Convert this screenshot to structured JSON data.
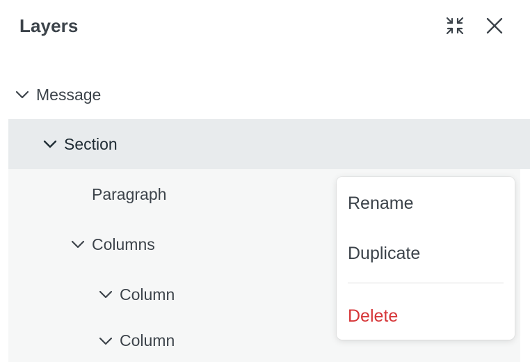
{
  "header": {
    "title": "Layers",
    "collapse_icon": "collapse-arrows-icon",
    "close_icon": "close-icon"
  },
  "tree": {
    "items": [
      {
        "label": "Message",
        "expanded": true,
        "depth": 0
      },
      {
        "label": "Section",
        "expanded": true,
        "depth": 1,
        "selected": true
      },
      {
        "label": "Paragraph",
        "expanded": false,
        "depth": 2
      },
      {
        "label": "Columns",
        "expanded": true,
        "depth": 2
      },
      {
        "label": "Column",
        "expanded": true,
        "depth": 3
      },
      {
        "label": "Column",
        "expanded": true,
        "depth": 3
      }
    ]
  },
  "context_menu": {
    "rename_label": "Rename",
    "duplicate_label": "Duplicate",
    "delete_label": "Delete",
    "delete_color": "#d63638"
  },
  "colors": {
    "text": "#3c434a",
    "selected_row": "#e8ebed",
    "tree_background": "#f6f7f7",
    "danger": "#d63638"
  }
}
